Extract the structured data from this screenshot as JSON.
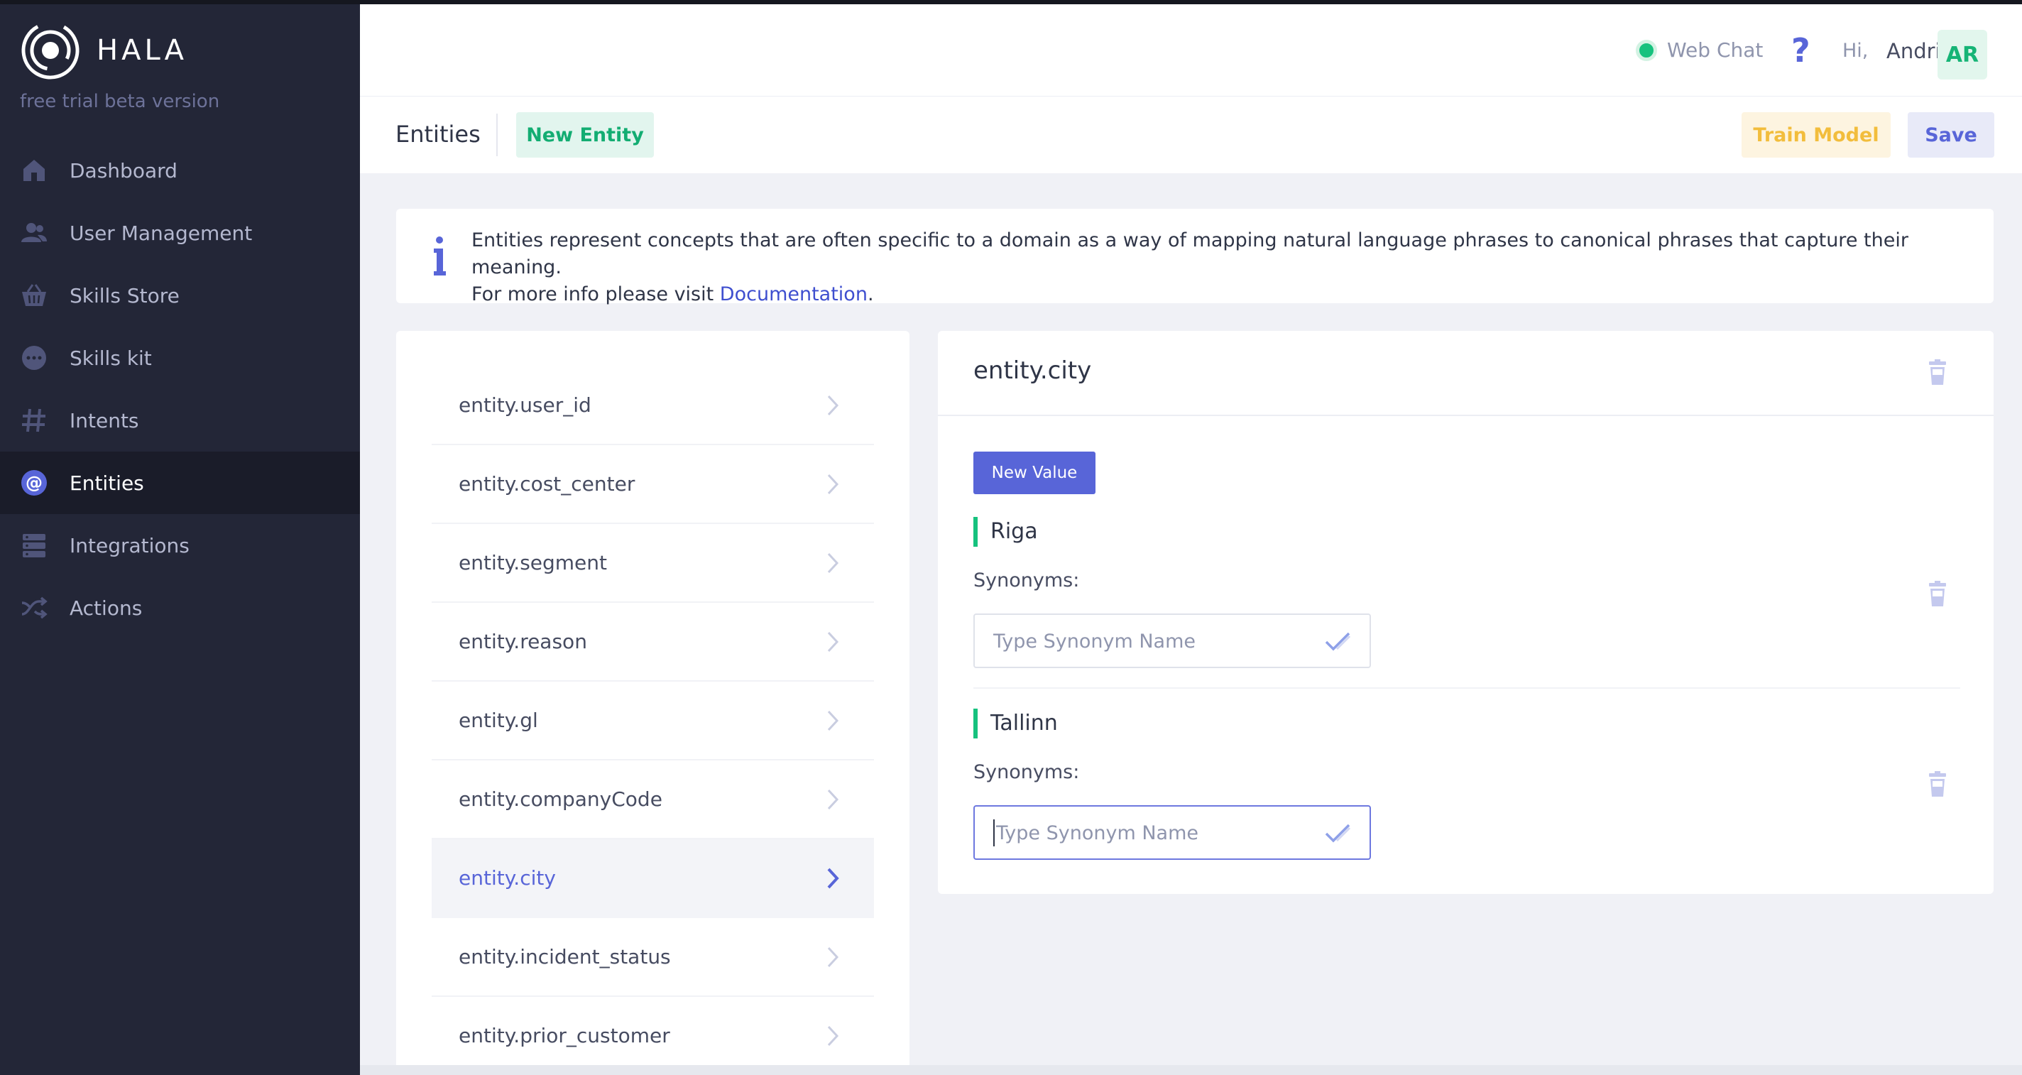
{
  "brand": {
    "name": "HALA",
    "tagline": "free trial beta version"
  },
  "sidebar": {
    "items": [
      {
        "label": "Dashboard",
        "icon": "home-icon",
        "active": false
      },
      {
        "label": "User Management",
        "icon": "users-icon",
        "active": false
      },
      {
        "label": "Skills Store",
        "icon": "basket-icon",
        "active": false
      },
      {
        "label": "Skills kit",
        "icon": "chat-bubble-icon",
        "active": false
      },
      {
        "label": "Intents",
        "icon": "hash-icon",
        "active": false
      },
      {
        "label": "Entities",
        "icon": "at-sign-icon",
        "active": true
      },
      {
        "label": "Integrations",
        "icon": "server-icon",
        "active": false
      },
      {
        "label": "Actions",
        "icon": "shuffle-icon",
        "active": false
      }
    ]
  },
  "header": {
    "webchat_label": "Web Chat",
    "help_symbol": "?",
    "greeting": "Hi,",
    "username": "Andrii",
    "avatar_initials": "AR"
  },
  "toolbar": {
    "page_title": "Entities",
    "new_entity_label": "New Entity",
    "train_label": "Train Model",
    "save_label": "Save"
  },
  "info": {
    "line1": "Entities represent concepts that are often specific to a domain as a way of mapping natural language phrases to canonical phrases that capture their meaning.",
    "line2_prefix": "For more info please visit ",
    "link_label": "Documentation",
    "line2_suffix": "."
  },
  "entities": [
    {
      "label": "entity.user_id",
      "active": false
    },
    {
      "label": "entity.cost_center",
      "active": false
    },
    {
      "label": "entity.segment",
      "active": false
    },
    {
      "label": "entity.reason",
      "active": false
    },
    {
      "label": "entity.gl",
      "active": false
    },
    {
      "label": "entity.companyCode",
      "active": false
    },
    {
      "label": "entity.city",
      "active": true
    },
    {
      "label": "entity.incident_status",
      "active": false
    },
    {
      "label": "entity.prior_customer",
      "active": false
    }
  ],
  "detail": {
    "title": "entity.city",
    "new_value_label": "New Value",
    "values": [
      {
        "name": "Riga",
        "synonyms_label": "Synonyms:",
        "placeholder": "Type Synonym Name",
        "input_value": ""
      },
      {
        "name": "Tallinn",
        "synonyms_label": "Synonyms:",
        "placeholder": "Type Synonym Name",
        "input_value": ""
      }
    ]
  },
  "colors": {
    "sidebar_bg": "#232637",
    "accent": "#5865d8",
    "green": "#16c27e",
    "train": "#f2bd3c"
  }
}
